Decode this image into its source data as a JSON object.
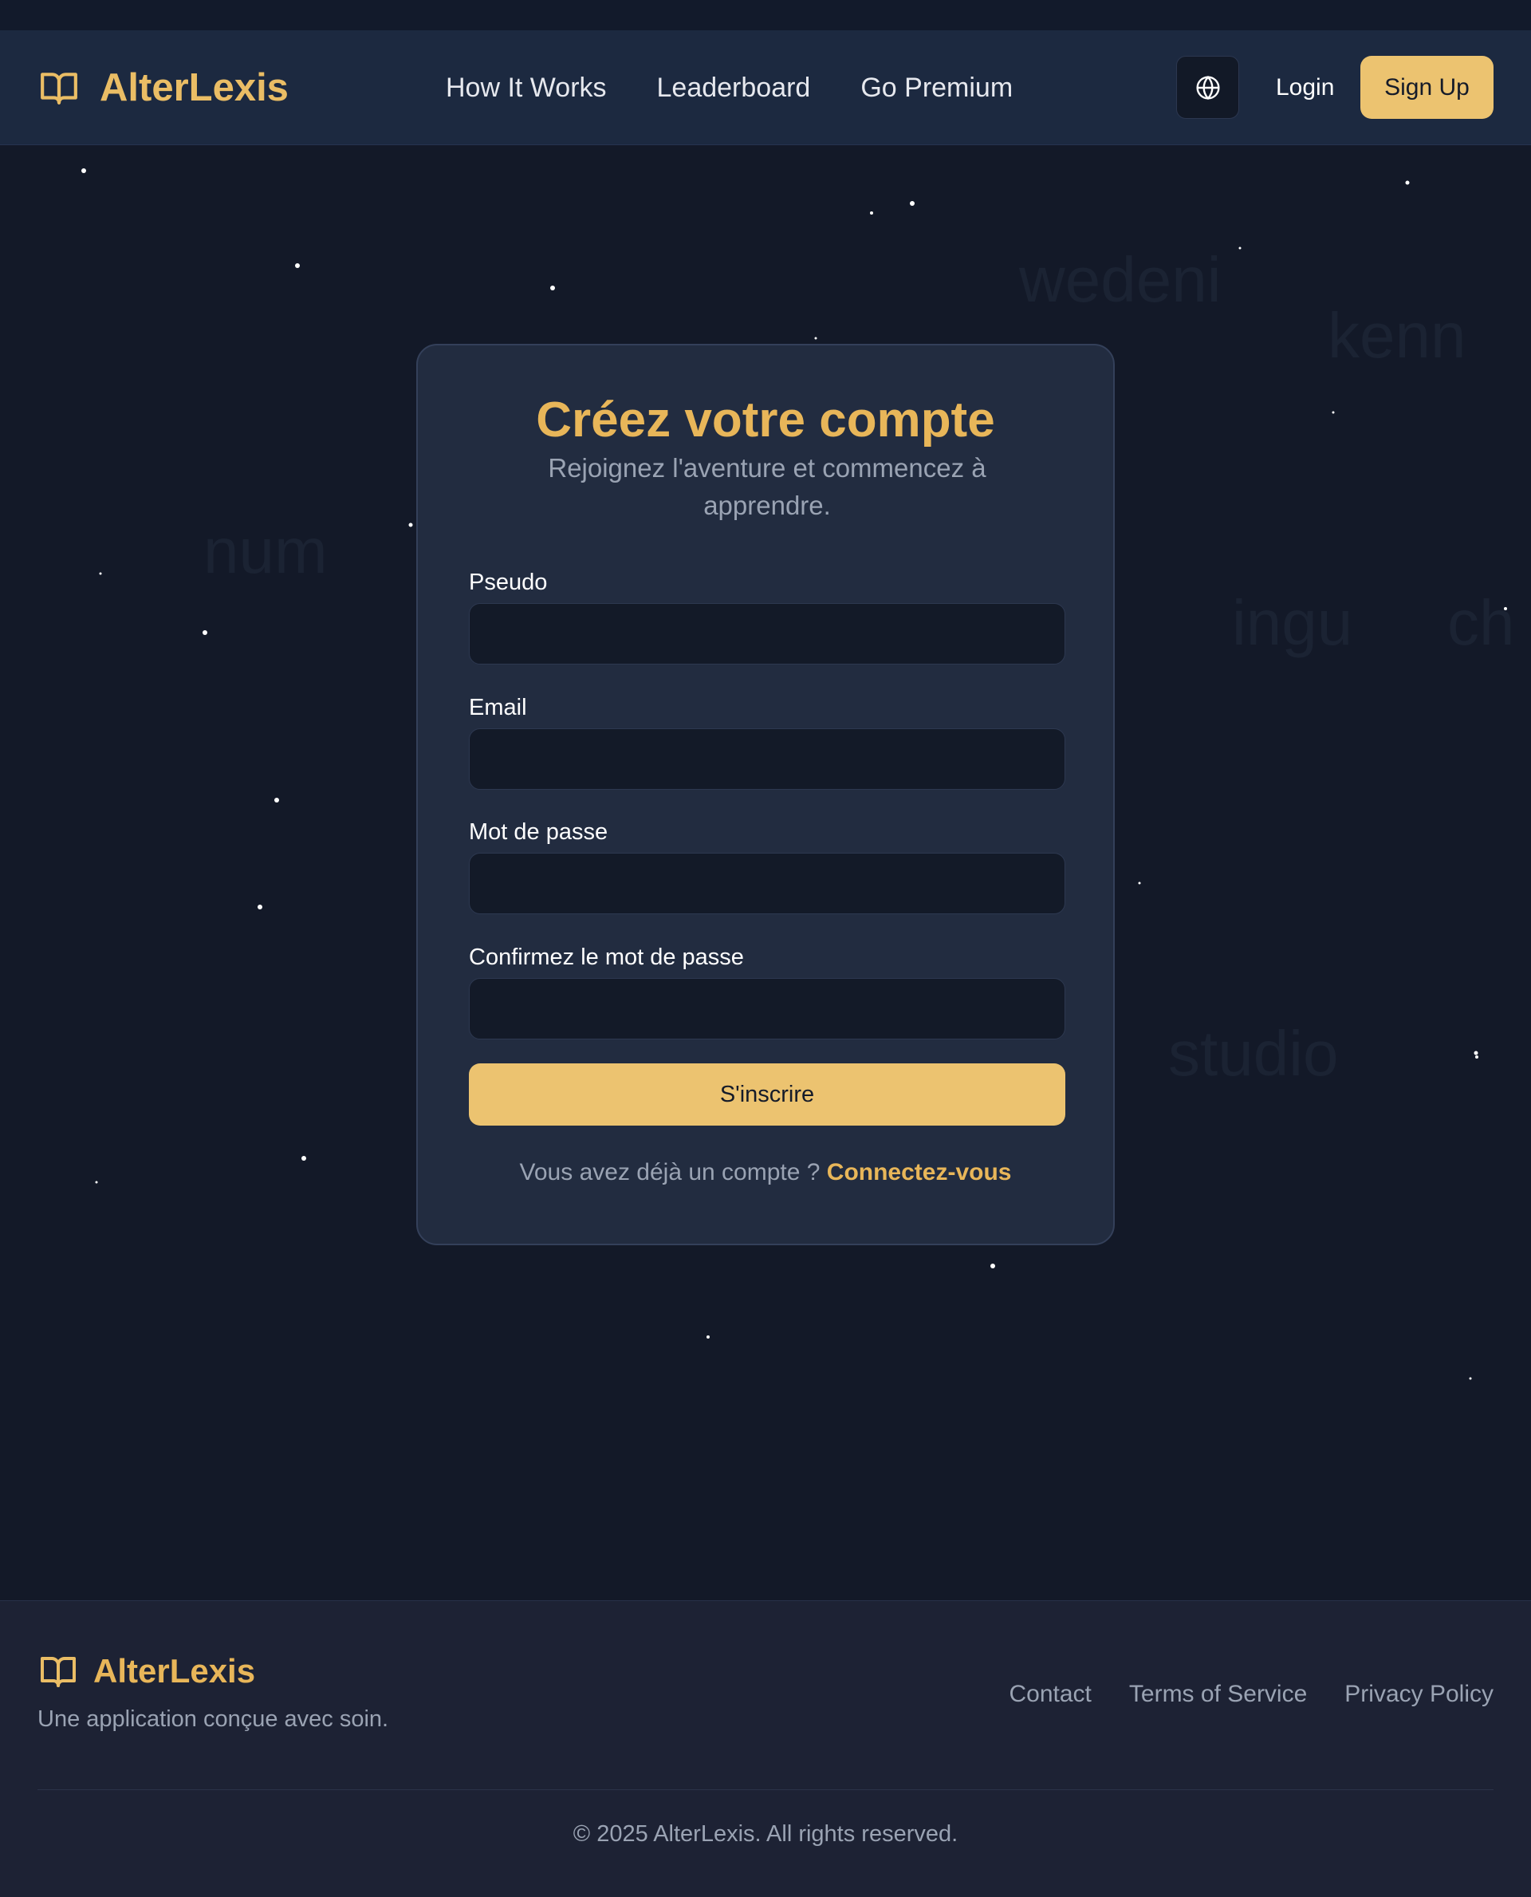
{
  "header": {
    "brand": "AlterLexis",
    "nav": [
      "How It Works",
      "Leaderboard",
      "Go Premium"
    ],
    "login_label": "Login",
    "signup_label": "Sign Up"
  },
  "background_words": [
    "wedeni",
    "kenn",
    "num",
    "ingu",
    "ch",
    "studio"
  ],
  "form": {
    "title": "Créez votre compte",
    "subtitle": "Rejoignez l'aventure et commencez à apprendre.",
    "fields": [
      {
        "label": "Pseudo",
        "value": ""
      },
      {
        "label": "Email",
        "value": ""
      },
      {
        "label": "Mot de passe",
        "value": ""
      },
      {
        "label": "Confirmez le mot de passe",
        "value": ""
      }
    ],
    "submit_label": "S'inscrire",
    "login_prompt": "Vous avez déjà un compte ?",
    "login_link": "Connectez-vous"
  },
  "footer": {
    "brand": "AlterLexis",
    "tagline": "Une application conçue avec soin.",
    "links": [
      "Contact",
      "Terms of Service",
      "Privacy Policy"
    ],
    "copyright": "© 2025 AlterLexis. All rights reserved."
  },
  "colors": {
    "background": "#131928",
    "navbar": "#1c2940",
    "card": "#222c40",
    "accent": "#eabd65",
    "button": "#ecc370",
    "input": "#131a28",
    "muted_text": "#9aa3b3"
  },
  "icons": {
    "logo": "open-book-icon",
    "language": "globe-icon"
  }
}
